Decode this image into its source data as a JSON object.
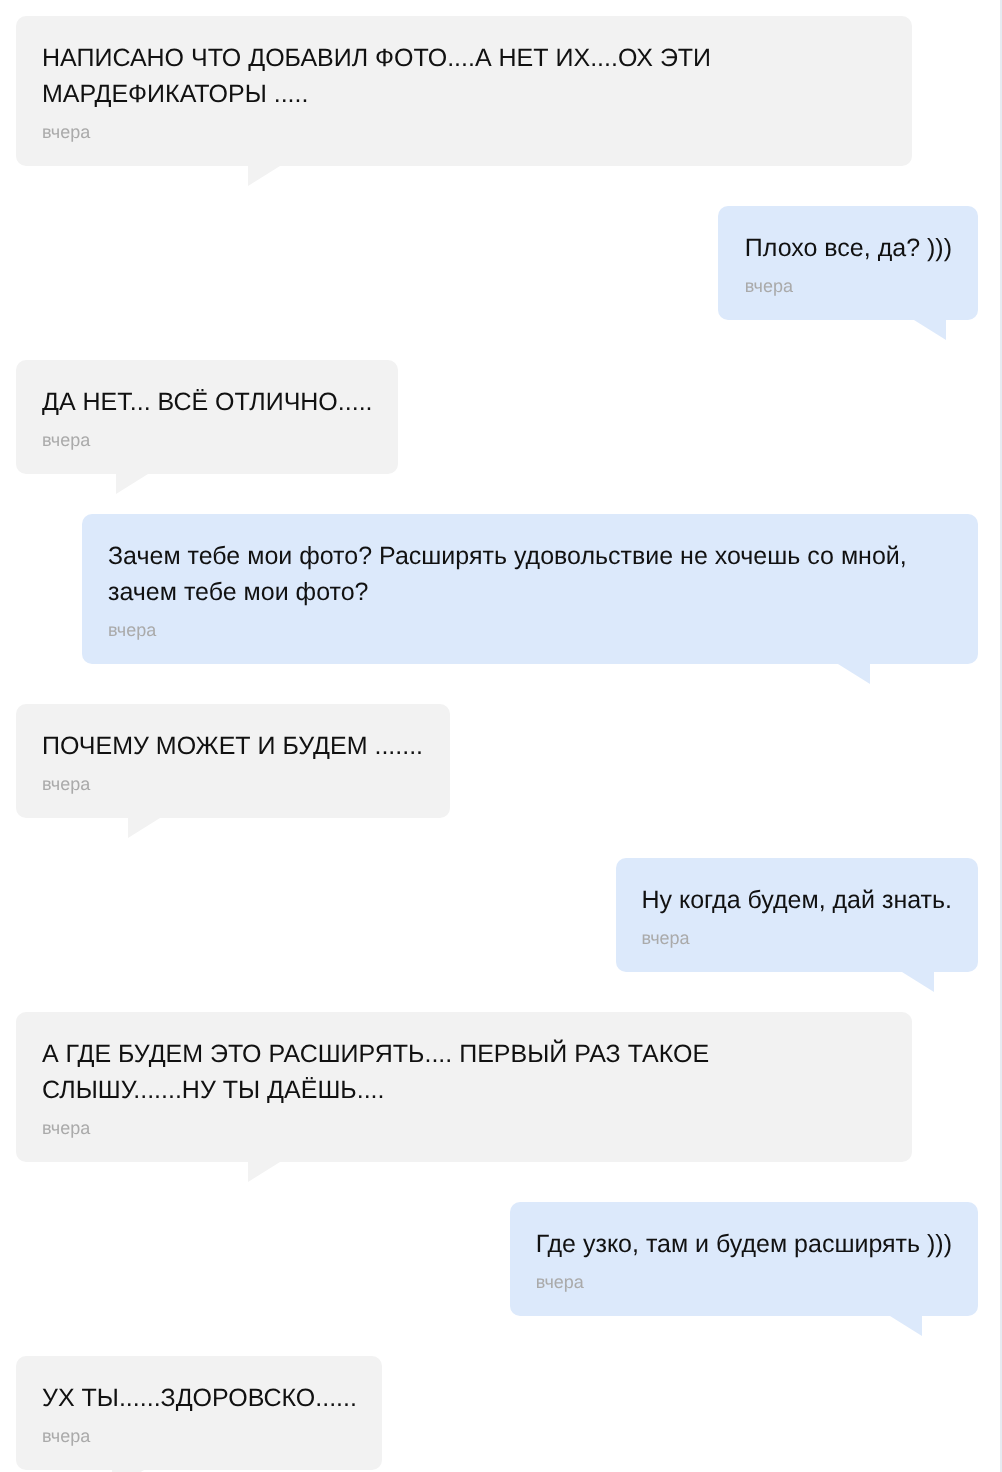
{
  "messages": [
    {
      "kind": "incoming",
      "text": "НАПИСАНО ЧТО ДОБАВИЛ ФОТО....А НЕТ ИХ....ОХ ЭТИ МАРДЕФИКАТОРЫ .....",
      "time": "вчера"
    },
    {
      "kind": "outgoing",
      "text": "Плохо все, да? )))",
      "time": "вчера"
    },
    {
      "kind": "incoming",
      "text": "ДА НЕТ... ВСЁ ОТЛИЧНО.....",
      "time": "вчера"
    },
    {
      "kind": "outgoing",
      "text": "Зачем тебе мои фото? Расширять удовольствие не хочешь со мной, зачем тебе мои фото?",
      "time": "вчера"
    },
    {
      "kind": "incoming",
      "text": "ПОЧЕМУ МОЖЕТ И БУДЕМ .......",
      "time": "вчера"
    },
    {
      "kind": "outgoing",
      "text": "Ну когда будем, дай знать.",
      "time": "вчера"
    },
    {
      "kind": "incoming",
      "text": "А ГДЕ БУДЕМ ЭТО РАСШИРЯТЬ.... ПЕРВЫЙ РАЗ ТАКОЕ СЛЫШУ.......НУ ТЫ ДАЁШЬ....",
      "time": "вчера"
    },
    {
      "kind": "outgoing",
      "text": "Где узко, там и будем расширять )))",
      "time": "вчера"
    },
    {
      "kind": "incoming",
      "text": "УХ ТЫ......ЗДОРОВСКО......",
      "time": "вчера"
    }
  ]
}
